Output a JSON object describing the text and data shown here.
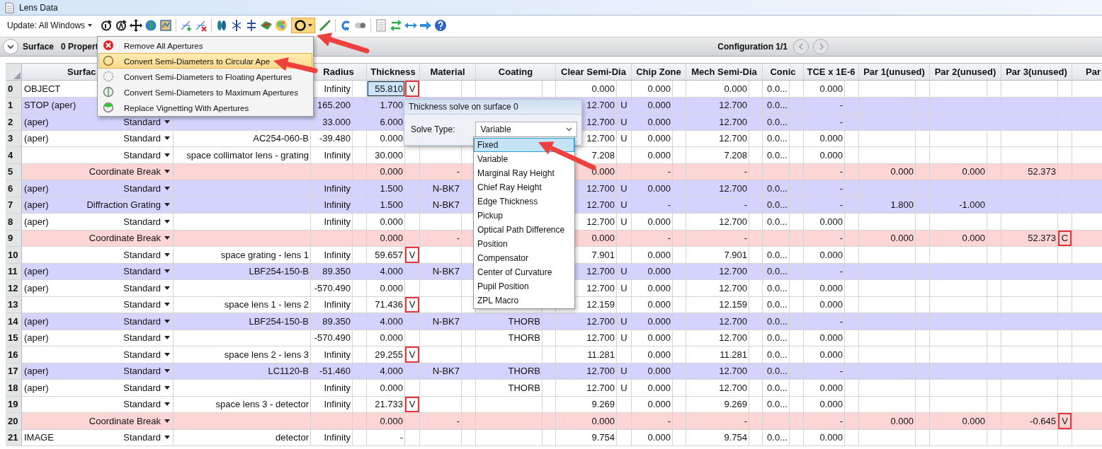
{
  "window": {
    "title": "Lens Data"
  },
  "toolbar": {
    "update_menu": "Update: All Windows",
    "aperture_tool_pressed": true
  },
  "surface_bar": {
    "title": "Surface",
    "properties": "0 Propert",
    "configuration": "Configuration 1/1"
  },
  "aperture_menu": {
    "items": [
      {
        "kind": "remove",
        "label": "Remove All Apertures",
        "selected": false
      },
      {
        "kind": "circular",
        "label": "Convert Semi-Diameters to Circular Ape",
        "selected": true
      },
      {
        "kind": "floating",
        "label": "Convert Semi-Diameters to Floating Apertures",
        "selected": false
      },
      {
        "kind": "maximum",
        "label": "Convert Semi-Diameters to Maximum Apertures",
        "selected": false
      },
      {
        "kind": "vignetting",
        "label": "Replace Vignetting With Apertures",
        "selected": false
      }
    ]
  },
  "table": {
    "columns": [
      "Surfac",
      "Radius",
      "Thickness",
      "Material",
      "Coating",
      "Clear Semi-Dia",
      "Chip Zone",
      "Mech Semi-Dia",
      "Conic",
      "TCE x 1E-6",
      "Par 1(unused)",
      "Par 2(unused)",
      "Par 3(unused)",
      "Par"
    ],
    "rows": [
      {
        "number": "0",
        "label": "OBJECT",
        "radius": "Infinity",
        "thickness": "55.810",
        "thickness_solve": "V",
        "clear_semi_dia": "0.000",
        "chip_zone": "0.000",
        "mech_semi_dia": "0.000",
        "conic": "0.0...",
        "tce": "0.000",
        "color": "#ffffff",
        "selected": true
      },
      {
        "number": "1",
        "label": "STOP (aper)",
        "radius": "165.200",
        "thickness": "1.700",
        "clear_semi_dia": "12.700",
        "clear_semi_dia_solve": "U",
        "chip_zone": "0.000",
        "mech_semi_dia": "12.700",
        "conic": "0.0...",
        "tce": "-",
        "color": "#d3d3fd",
        "selected": false
      },
      {
        "number": "2",
        "label": "(aper)",
        "type": "Standard",
        "radius": "33.000",
        "thickness": "6.000",
        "clear_semi_dia": "12.700",
        "clear_semi_dia_solve": "U",
        "chip_zone": "0.000",
        "mech_semi_dia": "12.700",
        "conic": "0.0...",
        "tce": "-",
        "color": "#d3d3fd",
        "selected": false
      },
      {
        "number": "3",
        "label": "(aper)",
        "type": "Standard",
        "comment": "AC254-060-B",
        "radius": "-39.480",
        "thickness": "0.000",
        "clear_semi_dia": "12.700",
        "clear_semi_dia_solve": "U",
        "chip_zone": "0.000",
        "mech_semi_dia": "12.700",
        "conic": "0.0...",
        "tce": "0.000",
        "color": "#ffffff",
        "selected": false
      },
      {
        "number": "4",
        "type": "Standard",
        "comment": "space collimator lens - grating",
        "radius": "Infinity",
        "thickness": "30.000",
        "clear_semi_dia": "7.208",
        "chip_zone": "0.000",
        "mech_semi_dia": "7.208",
        "conic": "0.0...",
        "tce": "0.000",
        "color": "#ffffff",
        "selected": false
      },
      {
        "number": "5",
        "type": "Coordinate Break",
        "thickness": "0.000",
        "material": "-",
        "clear_semi_dia": "0.000",
        "chip_zone": "-",
        "mech_semi_dia": "-",
        "tce": "-",
        "par_1": "0.000",
        "par_2": "0.000",
        "par_3": "52.373",
        "color": "#fdd5d5",
        "selected": false
      },
      {
        "number": "6",
        "label": "(aper)",
        "type": "Standard",
        "radius": "Infinity",
        "thickness": "1.500",
        "material": "N-BK7",
        "clear_semi_dia": "12.700",
        "clear_semi_dia_solve": "U",
        "chip_zone": "0.000",
        "mech_semi_dia": "12.700",
        "conic": "0.0...",
        "tce": "-",
        "color": "#d3d3fd",
        "selected": false
      },
      {
        "number": "7",
        "label": "(aper)",
        "type": "Diffraction Grating",
        "radius": "Infinity",
        "thickness": "1.500",
        "material": "N-BK7",
        "clear_semi_dia": "12.700",
        "clear_semi_dia_solve": "U",
        "chip_zone": "-",
        "mech_semi_dia": "-",
        "conic": "0.0...",
        "tce": "-",
        "par_1": "1.800",
        "par_2": "-1.000",
        "color": "#d3d3fd",
        "selected": false
      },
      {
        "number": "8",
        "label": "(aper)",
        "type": "Standard",
        "radius": "Infinity",
        "thickness": "0.000",
        "clear_semi_dia": "12.700",
        "clear_semi_dia_solve": "U",
        "chip_zone": "0.000",
        "mech_semi_dia": "12.700",
        "conic": "0.0...",
        "tce": "0.000",
        "color": "#ffffff",
        "selected": false
      },
      {
        "number": "9",
        "type": "Coordinate Break",
        "thickness": "0.000",
        "material": "-",
        "clear_semi_dia": "0.000",
        "chip_zone": "-",
        "mech_semi_dia": "-",
        "tce": "-",
        "par_1": "0.000",
        "par_2": "0.000",
        "par_3": "52.373",
        "par_3_solve": "C",
        "color": "#fdd5d5",
        "selected": false
      },
      {
        "number": "10",
        "type": "Standard",
        "comment": "space grating - lens 1",
        "radius": "Infinity",
        "thickness": "59.657",
        "thickness_solve": "V",
        "clear_semi_dia": "7.901",
        "chip_zone": "0.000",
        "mech_semi_dia": "7.901",
        "conic": "0.0...",
        "tce": "0.000",
        "color": "#ffffff",
        "selected": false
      },
      {
        "number": "11",
        "label": "(aper)",
        "type": "Standard",
        "comment": "LBF254-150-B",
        "radius": "89.350",
        "thickness": "4.000",
        "material": "N-BK7",
        "clear_semi_dia": "12.700",
        "clear_semi_dia_solve": "U",
        "chip_zone": "0.000",
        "mech_semi_dia": "12.700",
        "conic": "0.0...",
        "tce": "-",
        "color": "#d3d3fd",
        "selected": false
      },
      {
        "number": "12",
        "label": "(aper)",
        "type": "Standard",
        "radius": "-570.490",
        "thickness": "0.000",
        "clear_semi_dia": "12.700",
        "clear_semi_dia_solve": "U",
        "chip_zone": "0.000",
        "mech_semi_dia": "12.700",
        "conic": "0.0...",
        "tce": "0.000",
        "color": "#ffffff",
        "selected": false
      },
      {
        "number": "13",
        "type": "Standard",
        "comment": "space lens 1 - lens 2",
        "radius": "Infinity",
        "thickness": "71.436",
        "thickness_solve": "V",
        "clear_semi_dia": "12.159",
        "chip_zone": "0.000",
        "mech_semi_dia": "12.159",
        "conic": "0.0...",
        "tce": "0.000",
        "color": "#ffffff",
        "selected": false
      },
      {
        "number": "14",
        "label": "(aper)",
        "type": "Standard",
        "comment": "LBF254-150-B",
        "radius": "89.350",
        "thickness": "4.000",
        "material": "N-BK7",
        "coating": "THORB",
        "clear_semi_dia": "12.700",
        "clear_semi_dia_solve": "U",
        "chip_zone": "0.000",
        "mech_semi_dia": "12.700",
        "conic": "0.0...",
        "tce": "-",
        "color": "#d3d3fd",
        "selected": false
      },
      {
        "number": "15",
        "label": "(aper)",
        "type": "Standard",
        "radius": "-570.490",
        "thickness": "0.000",
        "coating": "THORB",
        "clear_semi_dia": "12.700",
        "clear_semi_dia_solve": "U",
        "chip_zone": "0.000",
        "mech_semi_dia": "12.700",
        "conic": "0.0...",
        "tce": "0.000",
        "color": "#ffffff",
        "selected": false
      },
      {
        "number": "16",
        "type": "Standard",
        "comment": "space lens 2 - lens 3",
        "radius": "Infinity",
        "thickness": "29.255",
        "thickness_solve": "V",
        "clear_semi_dia": "11.281",
        "chip_zone": "0.000",
        "mech_semi_dia": "11.281",
        "conic": "0.0...",
        "tce": "0.000",
        "color": "#ffffff",
        "selected": false
      },
      {
        "number": "17",
        "label": "(aper)",
        "type": "Standard",
        "comment": "LC1120-B",
        "radius": "-51.460",
        "thickness": "4.000",
        "material": "N-BK7",
        "coating": "THORB",
        "clear_semi_dia": "12.700",
        "clear_semi_dia_solve": "U",
        "chip_zone": "0.000",
        "mech_semi_dia": "12.700",
        "conic": "0.0...",
        "tce": "-",
        "color": "#d3d3fd",
        "selected": false
      },
      {
        "number": "18",
        "label": "(aper)",
        "type": "Standard",
        "radius": "Infinity",
        "thickness": "0.000",
        "coating": "THORB",
        "clear_semi_dia": "12.700",
        "clear_semi_dia_solve": "U",
        "chip_zone": "0.000",
        "mech_semi_dia": "12.700",
        "conic": "0.0...",
        "tce": "0.000",
        "color": "#ffffff",
        "selected": false
      },
      {
        "number": "19",
        "type": "Standard",
        "comment": "space lens 3 - detector",
        "radius": "Infinity",
        "thickness": "21.733",
        "thickness_solve": "V",
        "clear_semi_dia": "9.269",
        "chip_zone": "0.000",
        "mech_semi_dia": "9.269",
        "conic": "0.0...",
        "tce": "0.000",
        "color": "#ffffff",
        "selected": false
      },
      {
        "number": "20",
        "type": "Coordinate Break",
        "thickness": "0.000",
        "material": "-",
        "clear_semi_dia": "0.000",
        "chip_zone": "-",
        "mech_semi_dia": "-",
        "tce": "-",
        "par_1": "0.000",
        "par_2": "0.000",
        "par_3": "-0.645",
        "par_3_solve": "V",
        "color": "#fdd5d5",
        "selected": false
      },
      {
        "number": "21",
        "label": "IMAGE",
        "type": "Standard",
        "comment": "detector",
        "radius": "Infinity",
        "thickness": "-",
        "clear_semi_dia": "9.754",
        "chip_zone": "0.000",
        "mech_semi_dia": "9.754",
        "conic": "0.0...",
        "tce": "0.000",
        "color": "#ffffff",
        "selected": false
      }
    ]
  },
  "solve_dialog": {
    "title": "Thickness solve on surface 0",
    "solve_type_label": "Solve Type:",
    "solve_type_value": "Variable",
    "options": [
      {
        "label": "Fixed",
        "selected": true
      },
      {
        "label": "Variable",
        "selected": false
      },
      {
        "label": "Marginal Ray Height",
        "selected": false
      },
      {
        "label": "Chief Ray Height",
        "selected": false
      },
      {
        "label": "Edge Thickness",
        "selected": false
      },
      {
        "label": "Pickup",
        "selected": false
      },
      {
        "label": "Optical Path Difference",
        "selected": false
      },
      {
        "label": "Position",
        "selected": false
      },
      {
        "label": "Compensator",
        "selected": false
      },
      {
        "label": "Center of Curvature",
        "selected": false
      },
      {
        "label": "Pupil Position",
        "selected": false
      },
      {
        "label": "ZPL Macro",
        "selected": false
      }
    ]
  }
}
